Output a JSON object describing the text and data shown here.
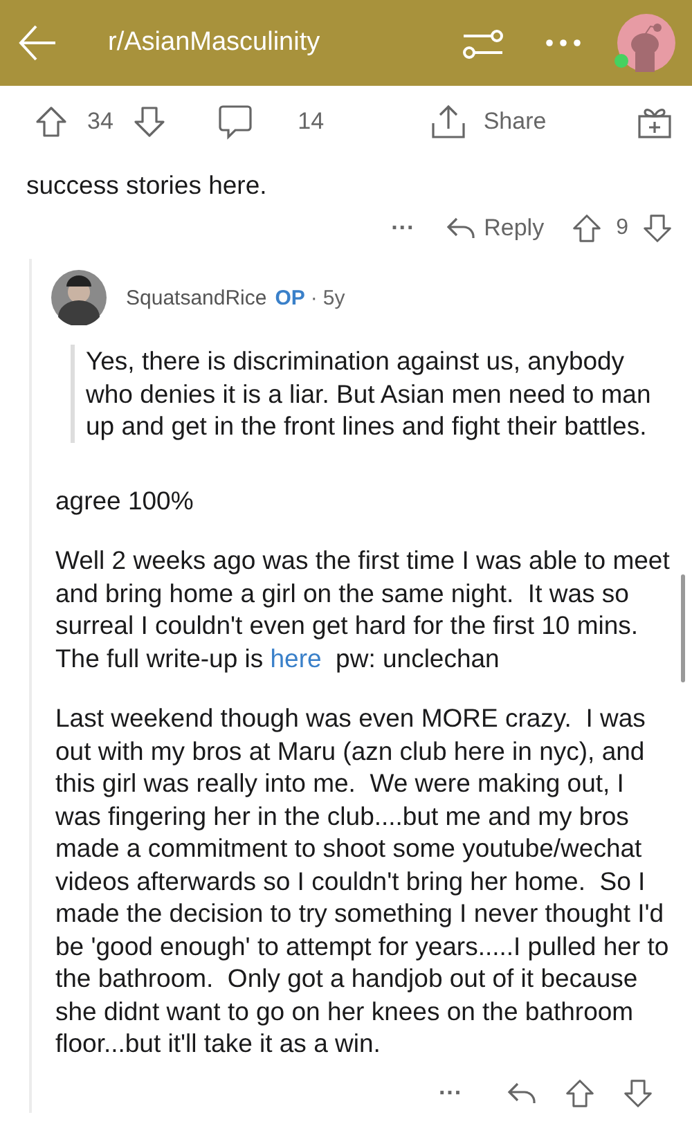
{
  "header": {
    "title": "r/AsianMasculinity",
    "online": true
  },
  "post_actions": {
    "votes": "34",
    "comments": "14",
    "share": "Share"
  },
  "post_text_tail": "success stories here.",
  "parent_actions": {
    "more": "···",
    "reply": "Reply",
    "votes": "9"
  },
  "comment": {
    "author": "SquatsandRice",
    "op_badge": "OP",
    "separator": "·",
    "age": "5y",
    "quote": "Yes, there is discrimination against us, anybody who denies it is a liar. But Asian men need to man up and get in the front lines and fight their battles.",
    "paragraphs": [
      {
        "before": "agree 100%"
      },
      {
        "before": "Well 2 weeks ago was the first time I was able to meet and bring home a girl on the same night.  It was so surreal I couldn't even get hard for the first 10 mins.  The full write-up is ",
        "link": "here",
        "after": "  pw: unclechan"
      },
      {
        "before": "Last weekend though was even MORE crazy.  I was out with my bros at Maru (azn club here in nyc), and this girl was really into me.  We were making out, I was fingering her in the club....but me and my bros made a commitment to shoot some youtube/wechat videos afterwards so I couldn't bring her home.  So I made the decision to try something I never thought I'd be 'good enough' to attempt for years.....I pulled her to the bathroom.  Only got a handjob out of it because she didnt want to go on her knees on the bathroom floor...but it'll take it as a win."
      }
    ],
    "more": "···"
  }
}
